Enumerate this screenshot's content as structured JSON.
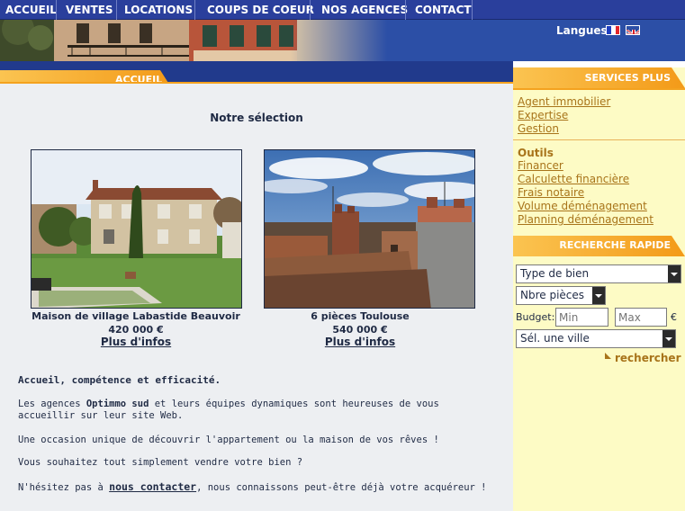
{
  "nav": {
    "items": [
      "ACCUEIL",
      "VENTES",
      "LOCATIONS",
      "COUPS DE COEUR",
      "NOS AGENCES",
      "CONTACT"
    ]
  },
  "header": {
    "languages_label": "Langues",
    "flags": [
      "flag-fr-icon",
      "flag-uk-icon"
    ]
  },
  "main": {
    "tab_label": "ACCUEIL",
    "section_title": "Notre sélection",
    "properties": [
      {
        "title": "Maison de village Labastide Beauvoir",
        "price": "420 000 €",
        "link": "Plus d'infos"
      },
      {
        "title": "6 pièces Toulouse",
        "price": "540 000 €",
        "link": "Plus d'infos"
      }
    ],
    "intro_heading": "Accueil, compétence et efficacité.",
    "para1_before": "Les agences ",
    "para1_brand": "Optimmo sud",
    "para1_after": " et leurs équipes dynamiques sont heureuses de vous accueillir sur leur site Web.",
    "para2": "Une occasion unique de découvrir l'appartement ou la maison de vos rêves !",
    "para3": "Vous souhaitez tout simplement vendre votre bien ?",
    "para4_before": "N'hésitez pas à ",
    "para4_link": "nous contacter",
    "para4_after": ", nous connaissons peut-être déjà votre acquéreur !"
  },
  "sidebar": {
    "services_title": "SERVICES PLUS",
    "services_links": [
      "Agent immobilier",
      "Expertise",
      "Gestion"
    ],
    "outils_label": "Outils",
    "outils_links": [
      "Financer",
      "Calculette financière",
      "Frais notaire",
      "Volume déménagement",
      "Planning déménagement"
    ],
    "search_title": "RECHERCHE RAPIDE",
    "type_select": "Type de bien",
    "rooms_select": "Nbre pièces",
    "budget_label": "Budget:",
    "min_placeholder": "Min",
    "max_placeholder": "Max",
    "currency": "€",
    "city_select": "Sél. une ville",
    "search_label": "rechercher"
  },
  "colors": {
    "nav_bg": "#2a3f9c",
    "accent_orange": "#f4a21f",
    "sidebar_bg": "#fdfbc5",
    "link_brown": "#a8741a",
    "main_bg": "#edeff2"
  }
}
